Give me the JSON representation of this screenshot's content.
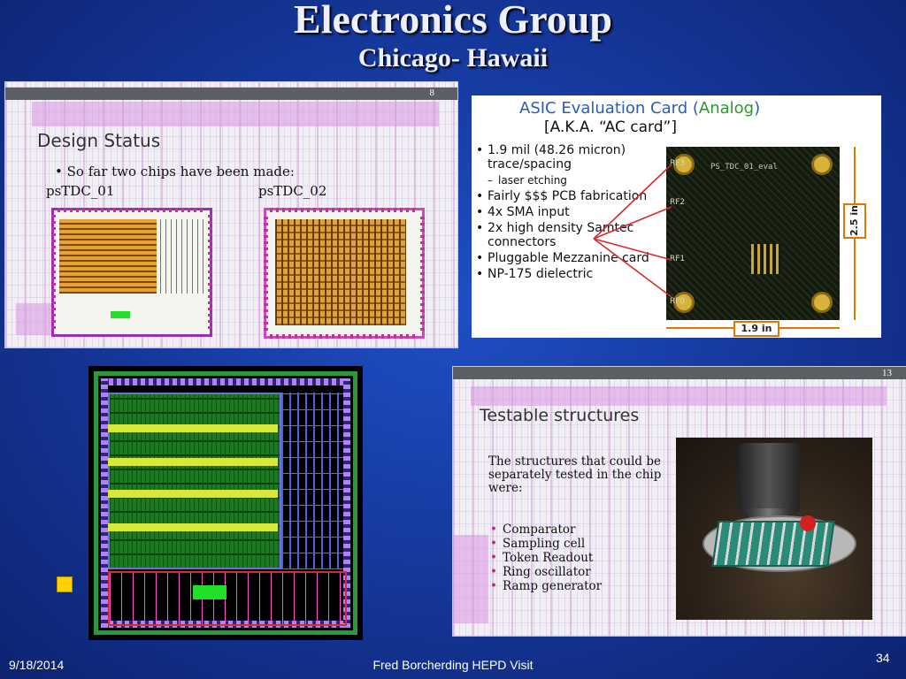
{
  "slide": {
    "title": "Electronics Group",
    "subtitle": "Chicago- Hawaii"
  },
  "design_status": {
    "slide_number": "8",
    "heading": "Design Status",
    "bullet": "So far two chips have been made:",
    "chip1_label": "psTDC_01",
    "chip2_label": "psTDC_02"
  },
  "asic_card": {
    "title_prefix": "ASIC Evaluation Card (",
    "title_highlight": "Analog",
    "title_suffix": ")",
    "subtitle": "[A.K.A. “AC card”]",
    "items": [
      "1.9 mil (48.26 micron) trace/spacing",
      "laser etching",
      "Fairly $$$ PCB fabrication",
      "4x SMA input",
      "2x high density Samtec connectors",
      "Pluggable Mezzanine card",
      "NP-175 dielectric"
    ],
    "board_label": "PS_TDC_01_eval",
    "rf_labels": [
      "RF3",
      "RF2",
      "RF1",
      "RF0"
    ],
    "height_dim": "2.5 in",
    "width_dim": "1.9 in"
  },
  "testable_structures": {
    "slide_number": "13",
    "heading": "Testable structures",
    "intro": "The structures that could be separately tested in the chip were:",
    "items": [
      "Comparator",
      "Sampling cell",
      "Token Readout",
      "Ring oscillator",
      "Ramp generator"
    ]
  },
  "footer": {
    "date": "9/18/2014",
    "center": "Fred Borcherding HEPD Visit",
    "page": "34"
  },
  "colors": {
    "background": "#163aa0",
    "title_text": "#eef0ff",
    "bullet_accent": "#ffd100",
    "asic_blue": "#2a5cb8",
    "asic_green": "#2a9a2a"
  }
}
